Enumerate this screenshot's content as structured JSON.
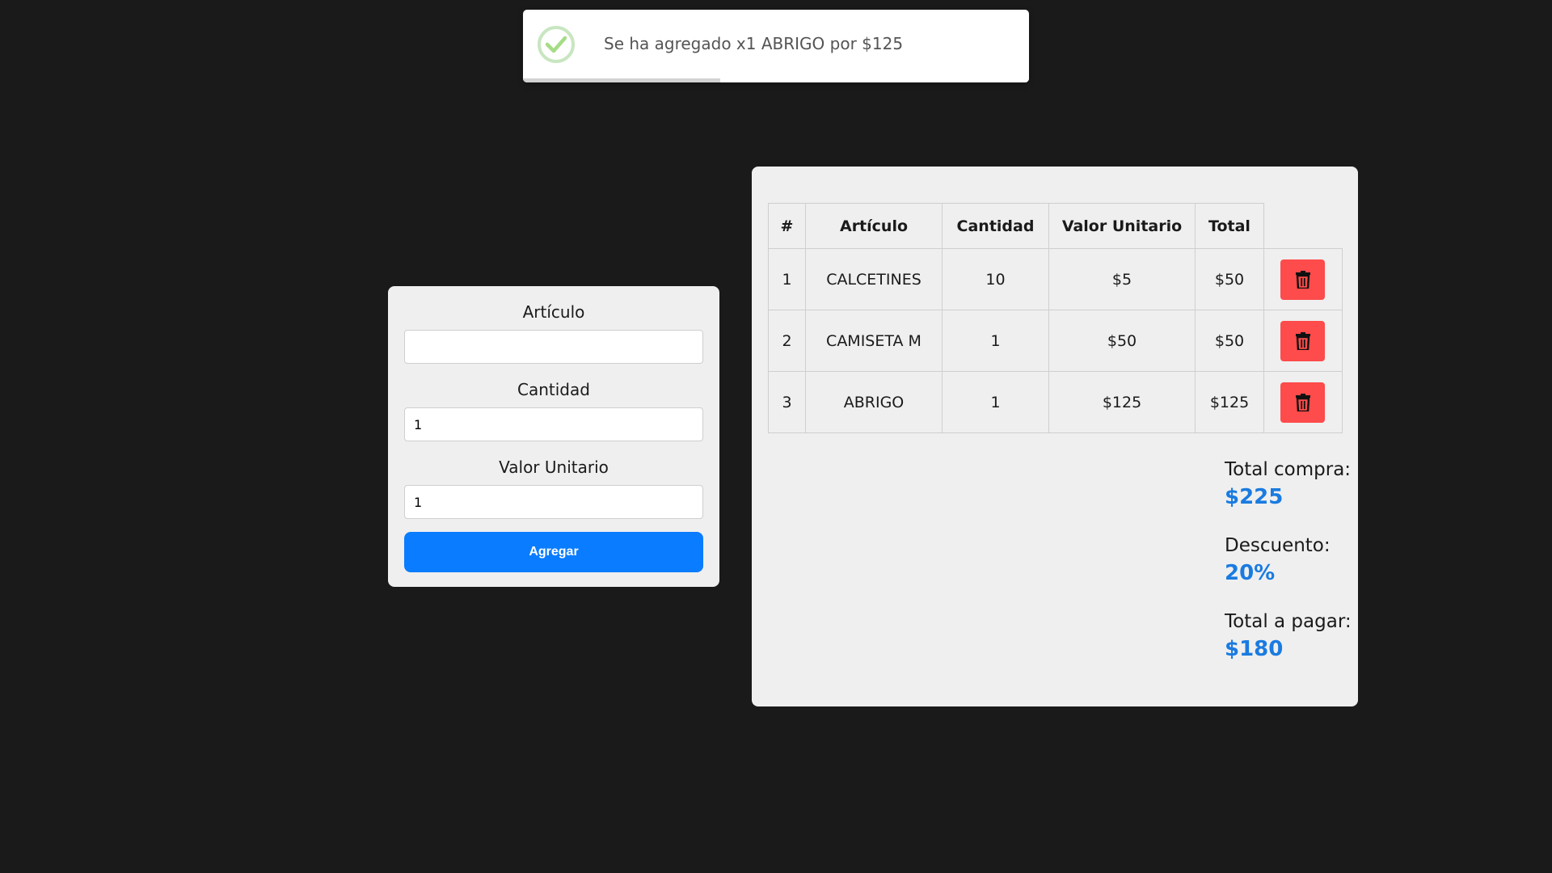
{
  "colors": {
    "background": "#1a1a1a",
    "card": "#efefef",
    "primary_button": "#0a7cff",
    "delete_button": "#fe4b4b",
    "summary_value": "#1a7be0",
    "toast_check": "#a5dc86"
  },
  "toast": {
    "icon": "check-circle-icon",
    "message": "Se ha agregado x1 ABRIGO por $125",
    "progress_fraction": 0.39
  },
  "form": {
    "articulo_label": "Artículo",
    "articulo_value": "",
    "cantidad_label": "Cantidad",
    "cantidad_value": "1",
    "valor_label": "Valor Unitario",
    "valor_value": "1",
    "submit_label": "Agregar"
  },
  "table": {
    "headers": [
      "#",
      "Artículo",
      "Cantidad",
      "Valor Unitario",
      "Total"
    ],
    "rows": [
      {
        "num": "1",
        "articulo": "CALCETINES",
        "cantidad": "10",
        "valor": "$5",
        "total": "$50",
        "action_icon": "trash-icon"
      },
      {
        "num": "2",
        "articulo": "CAMISETA M",
        "cantidad": "1",
        "valor": "$50",
        "total": "$50",
        "action_icon": "trash-icon"
      },
      {
        "num": "3",
        "articulo": "ABRIGO",
        "cantidad": "1",
        "valor": "$125",
        "total": "$125",
        "action_icon": "trash-icon"
      }
    ]
  },
  "summary": {
    "total_compra_label": "Total compra:",
    "total_compra_value": "$225",
    "descuento_label": "Descuento:",
    "descuento_value": "20%",
    "total_pagar_label": "Total a pagar:",
    "total_pagar_value": "$180"
  }
}
